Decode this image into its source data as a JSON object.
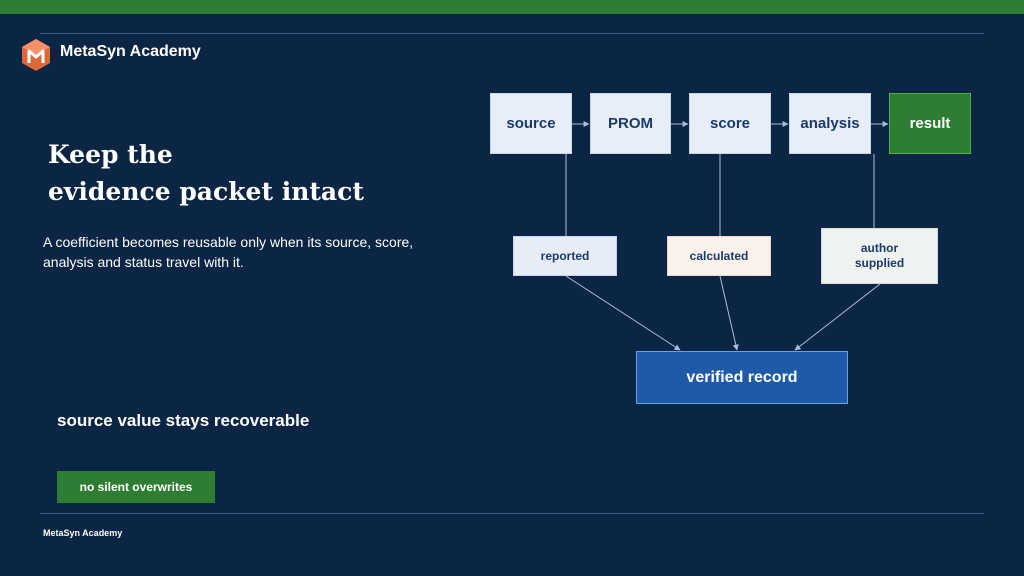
{
  "brand": {
    "name": "MetaSyn Academy"
  },
  "slide": {
    "title_line1": "Keep the",
    "title_line2": "evidence packet intact",
    "subtitle": "A coefficient becomes reusable only when its source, score, analysis and status travel with it.",
    "tagline": "source value stays recoverable",
    "badge": "no silent overwrites"
  },
  "diagram": {
    "flow": [
      "source",
      "PROM",
      "score",
      "analysis",
      "result"
    ],
    "statuses": [
      "reported",
      "calculated",
      "author supplied"
    ],
    "target": "verified record"
  },
  "footer": {
    "text": "MetaSyn Academy"
  },
  "colors": {
    "background": "#0b2545",
    "accent_green": "#2e7d32",
    "verified_blue": "#1e5aa8",
    "node_light": "#e8eef8"
  }
}
